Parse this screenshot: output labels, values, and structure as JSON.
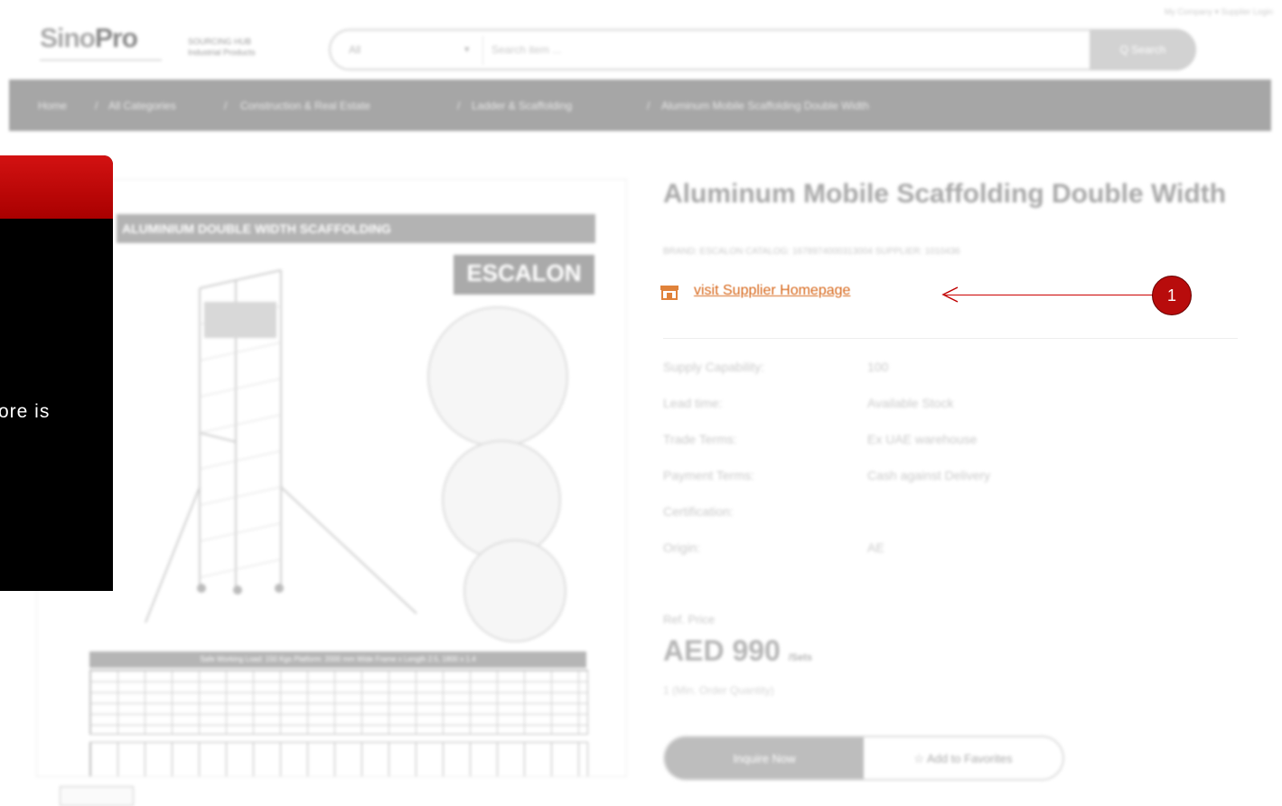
{
  "header": {
    "logo_text_a": "Sino",
    "logo_text_b": "Pro",
    "tagline_1": "SOURCING HUB",
    "tagline_2": "Industrial Products",
    "top_links": "My Company ▾   Supplier Login",
    "search": {
      "category": "All",
      "placeholder": "Search item ...",
      "button": "Q Search"
    }
  },
  "breadcrumb": [
    "Home",
    "All Categories",
    "Construction & Real Estate",
    "Ladder & Scaffolding",
    "Aluminum Mobile Scaffolding Double Width"
  ],
  "breadcrumb_sep": "/",
  "overlay": {
    "text": "ore is"
  },
  "image": {
    "banner": "ALUMINIUM DOUBLE WIDTH SCAFFOLDING",
    "brand": "ESCALON",
    "spec_table_title": "Safe Working Load: 150 Kgs Platform: 2000 mm Wide Frame x Length 2.5, 1800 x 1.4"
  },
  "product": {
    "title": "Aluminum Mobile Scaffolding Double Width",
    "ids": "BRAND: ESCALON    CATALOG: 1678974000313004    SUPPLIER: 1010436",
    "supplier_link": "visit Supplier Homepage",
    "specs": [
      {
        "label": "Supply Capability:",
        "value": "100"
      },
      {
        "label": "Lead time:",
        "value": "Available Stock"
      },
      {
        "label": "Trade Terms:",
        "value": "Ex UAE warehouse"
      },
      {
        "label": "Payment Terms:",
        "value": "Cash against Delivery"
      },
      {
        "label": "Certification:",
        "value": ""
      },
      {
        "label": "Origin:",
        "value": "AE"
      }
    ],
    "ref_price_label": "Ref. Price",
    "price": "AED 990",
    "price_unit": "/Sets",
    "moq": "1 (Min. Order Quantity)",
    "inquire_label": "Inquire Now",
    "favorite_label": "☆ Add to Favorites"
  },
  "annotation": {
    "badge": "1",
    "color": "#c00000"
  }
}
